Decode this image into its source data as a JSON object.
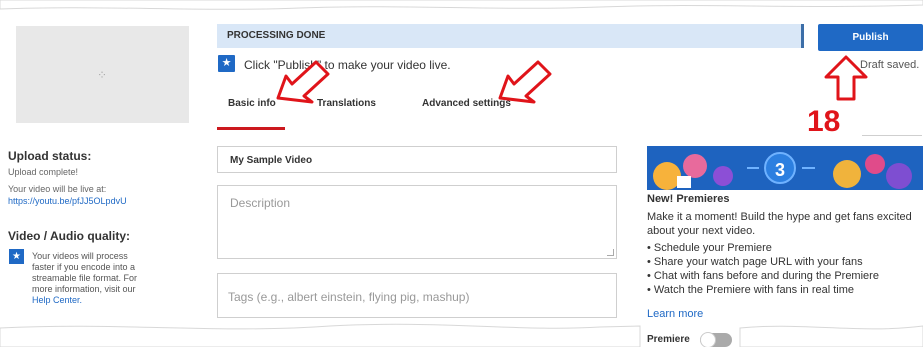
{
  "processing": {
    "status": "PROCESSING DONE"
  },
  "publish": {
    "label": "Publish",
    "draft_status": "Draft saved."
  },
  "notice": {
    "message": "Click \"Publish\" to make your video live."
  },
  "tabs": [
    {
      "label": "Basic info",
      "active": true
    },
    {
      "label": "Translations",
      "active": false
    },
    {
      "label": "Advanced settings",
      "active": false
    }
  ],
  "annotation": {
    "number": "18"
  },
  "upload": {
    "status_heading": "Upload status:",
    "status_text": "Upload complete!",
    "live_at_label": "Your video will be live at:",
    "live_url": "https://youtu.be/pfJJ5OLpdvU"
  },
  "quality": {
    "heading": "Video / Audio quality:",
    "text_lines": [
      "Your videos will process",
      "faster if you encode into a",
      "streamable file format. For",
      "more information, visit our"
    ],
    "link": "Help Center."
  },
  "form": {
    "title_value": "My Sample Video",
    "description_placeholder": "Description",
    "tags_placeholder": "Tags (e.g., albert einstein, flying pig, mashup)"
  },
  "promo": {
    "banner_number": "3",
    "heading": "New! Premieres",
    "description": "Make it a moment! Build the hype and get fans excited about your next video.",
    "bullets": [
      "Schedule your Premiere",
      "Share your watch page URL with your fans",
      "Chat with fans before and during the Premiere",
      "Watch the Premiere with fans in real time"
    ],
    "learn_more": "Learn more",
    "toggle_label": "Premiere",
    "toggle_on": false
  },
  "colors": {
    "accent": "#1f69c5",
    "annotation_red": "#e0141a",
    "tab_underline": "#cc181e",
    "processing_bg": "#d9e7f7"
  },
  "icons": [
    "loading-spinner-icon",
    "star-icon",
    "red-arrow-icon",
    "resize-handle-icon"
  ]
}
